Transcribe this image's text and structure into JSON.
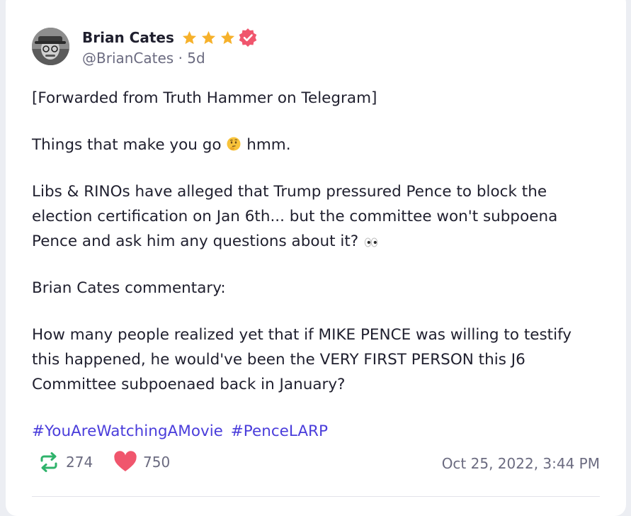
{
  "post": {
    "author": {
      "display_name": "Brian Cates",
      "handle": "@BrianCates",
      "separator": "·",
      "age": "5d",
      "stars": 3,
      "verified": true
    },
    "paragraphs": [
      "[Forwarded from Truth Hammer on Telegram]",
      "Things that make you go",
      "hmm.",
      "Libs & RINOs have alleged that Trump pressured Pence to block the election certification on Jan 6th... but the committee won't subpoena Pence and ask him any questions about it?",
      "Brian Cates commentary:",
      "How many people realized yet that if MIKE PENCE was willing to testify this happened, he would've been the VERY FIRST PERSON this J6 Committee subpoenaed back in January?"
    ],
    "hashtags": [
      "#YouAreWatchingAMovie",
      "#PenceLARP"
    ],
    "stats": {
      "reposts": "274",
      "likes": "750"
    },
    "timestamp": "Oct 25, 2022, 3:44 PM"
  },
  "colors": {
    "star": "#f6b12b",
    "verified": "#f0566d",
    "hashtag": "#4a3ddb",
    "repost": "#2fb36b",
    "like": "#f0566d"
  },
  "icons": {
    "star": "star-icon",
    "verified": "verified-badge-icon",
    "repost": "repost-icon",
    "like": "heart-icon",
    "thinking": "thinking-face-emoji",
    "eyes": "eyes-emoji"
  }
}
